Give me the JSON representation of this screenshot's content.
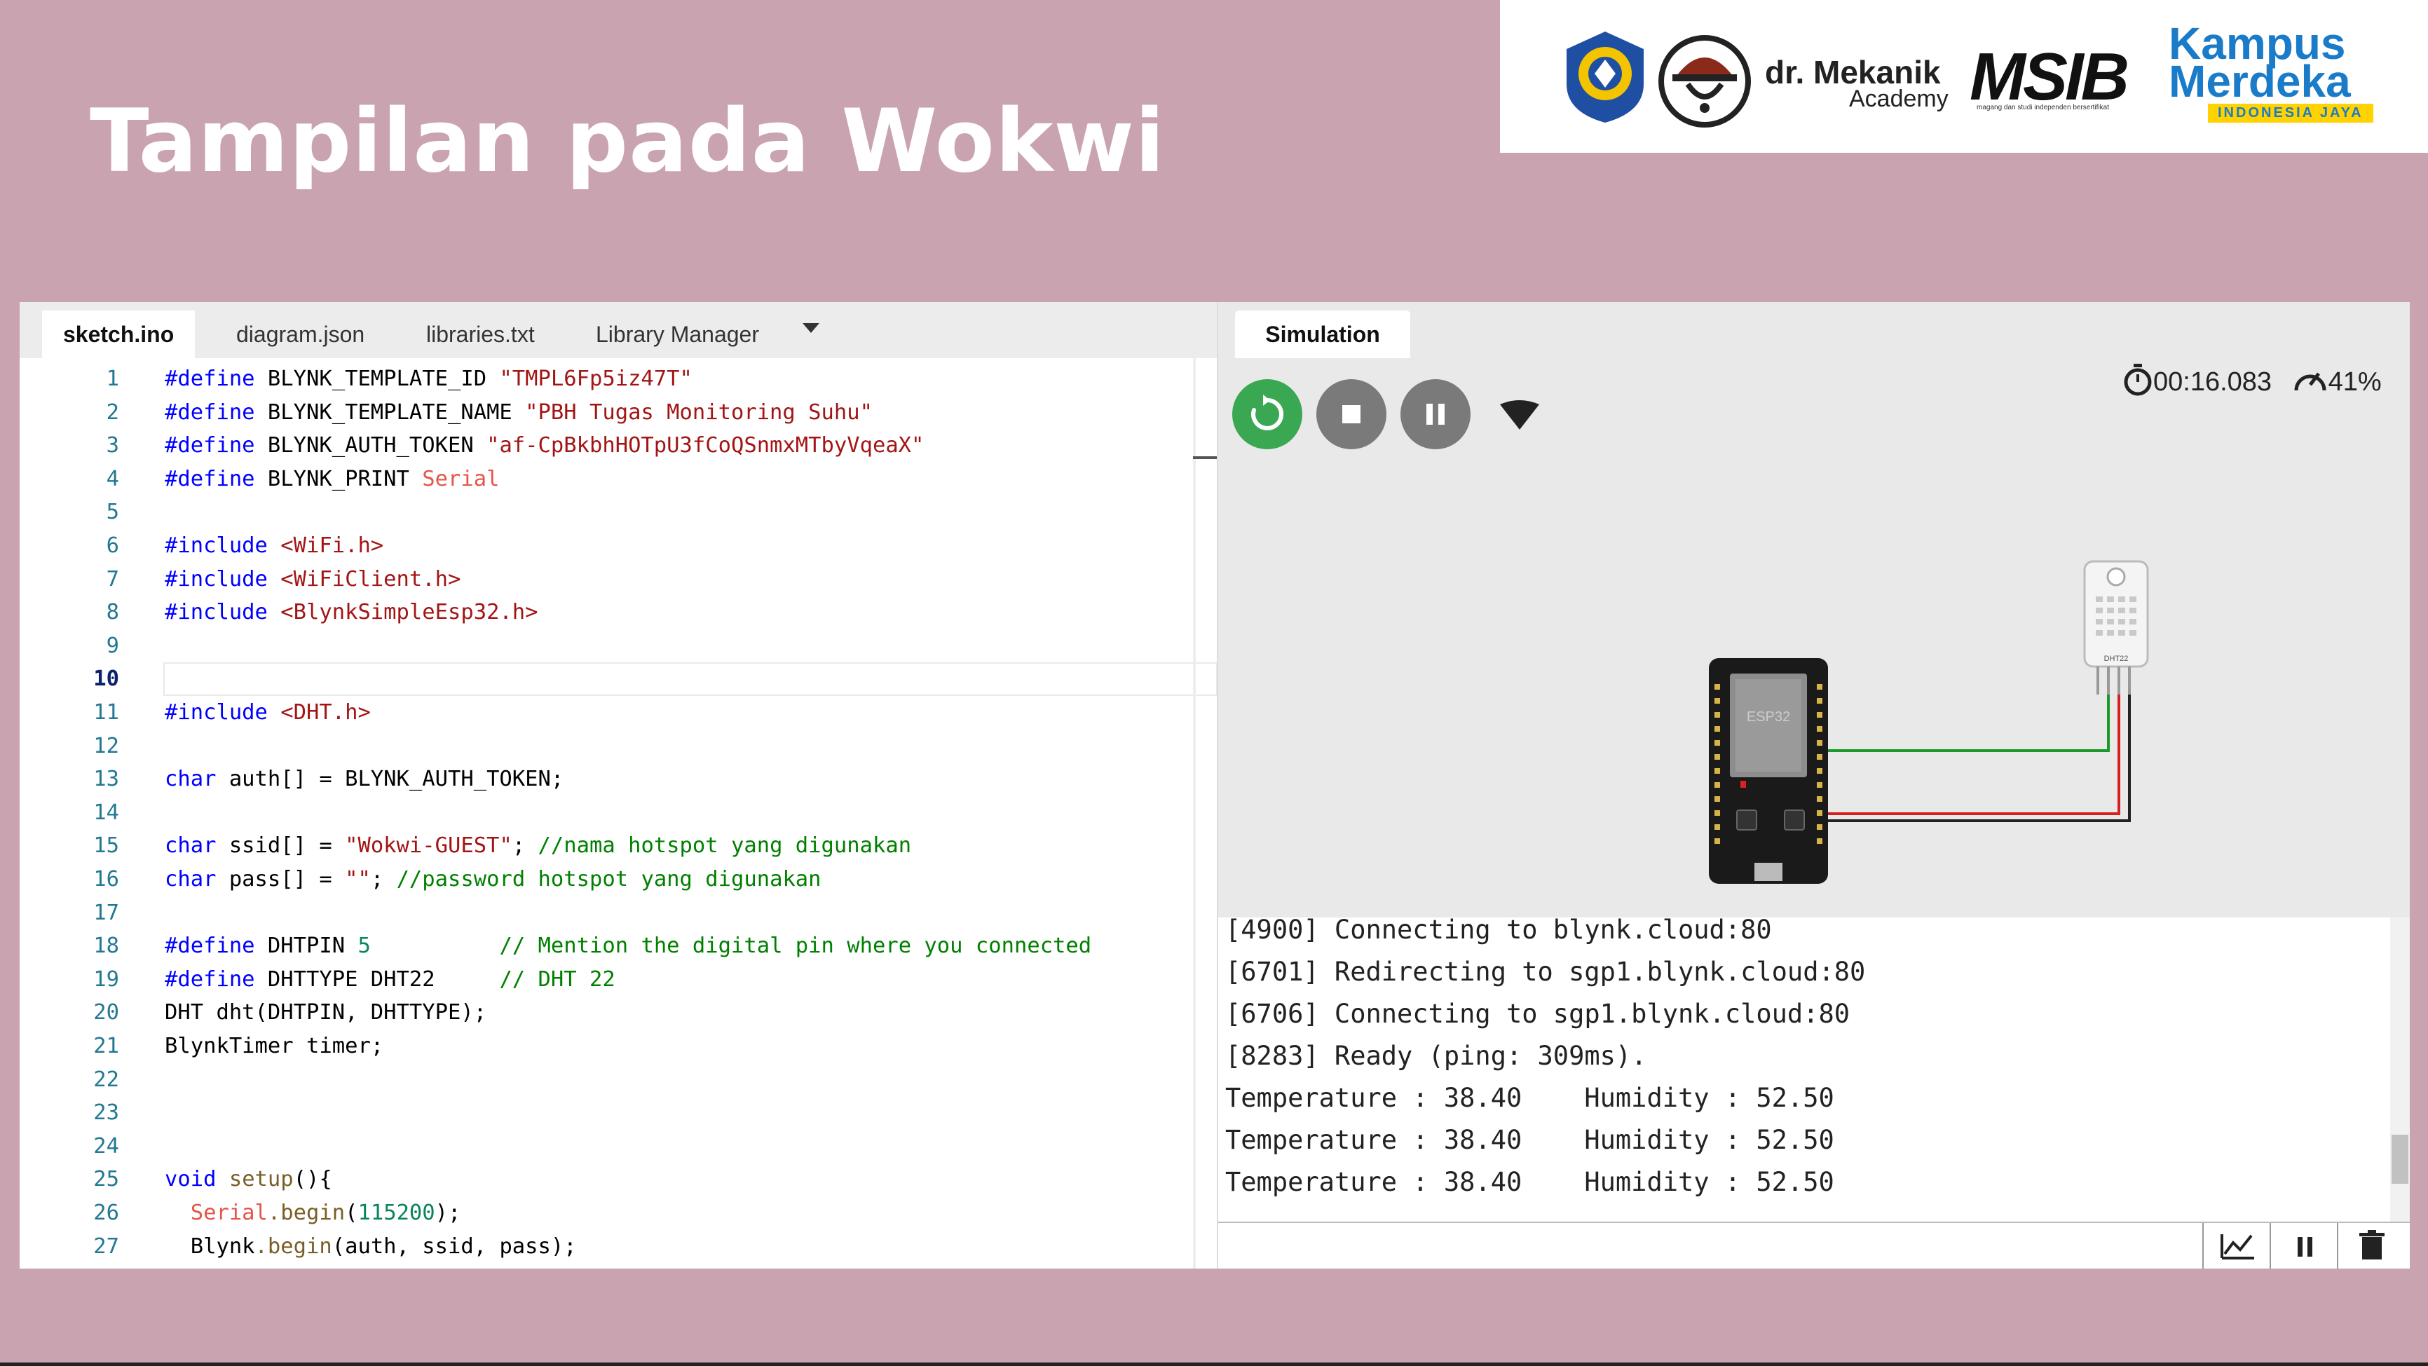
{
  "slide": {
    "title": "Tampilan pada Wokwi",
    "logos": {
      "academy_line1": "dr. Mekanik",
      "academy_line2": "Academy",
      "msib": "MSIB",
      "msib_tagline": "magang dan studi independen bersertifikat",
      "kampus_line1": "Kampus",
      "kampus_line2": "Merdeka",
      "kampus_line3": "INDONESIA JAYA"
    }
  },
  "editor": {
    "tabs": [
      "sketch.ino",
      "diagram.json",
      "libraries.txt",
      "Library Manager"
    ],
    "active_tab": "sketch.ino",
    "current_line": 10,
    "lines": [
      {
        "n": "1",
        "segs": [
          [
            "pp",
            "#define"
          ],
          [
            "",
            "BLYNK_TEMPLATE_ID "
          ],
          [
            "str",
            "\"TMPL6Fp5iz47T\""
          ]
        ]
      },
      {
        "n": "2",
        "segs": [
          [
            "pp",
            "#define"
          ],
          [
            "",
            "BLYNK_TEMPLATE_NAME "
          ],
          [
            "str",
            "\"PBH Tugas Monitoring Suhu\""
          ]
        ]
      },
      {
        "n": "3",
        "segs": [
          [
            "pp",
            "#define"
          ],
          [
            "",
            "BLYNK_AUTH_TOKEN "
          ],
          [
            "str",
            "\"af-CpBkbhHOTpU3fCoQSnmxMTbyVqeaX\""
          ]
        ]
      },
      {
        "n": "4",
        "segs": [
          [
            "pp",
            "#define"
          ],
          [
            "",
            "BLYNK_PRINT "
          ],
          [
            "red",
            "Serial"
          ]
        ]
      },
      {
        "n": "5",
        "segs": []
      },
      {
        "n": "6",
        "segs": [
          [
            "pp",
            "#include"
          ],
          [
            "str",
            "<WiFi.h>"
          ]
        ]
      },
      {
        "n": "7",
        "segs": [
          [
            "pp",
            "#include"
          ],
          [
            "str",
            "<WiFiClient.h>"
          ]
        ]
      },
      {
        "n": "8",
        "segs": [
          [
            "pp",
            "#include"
          ],
          [
            "str",
            "<BlynkSimpleEsp32.h>"
          ]
        ]
      },
      {
        "n": "9",
        "segs": []
      },
      {
        "n": "10",
        "segs": []
      },
      {
        "n": "11",
        "segs": [
          [
            "pp",
            "#include"
          ],
          [
            "str",
            "<DHT.h>"
          ]
        ]
      },
      {
        "n": "12",
        "segs": []
      },
      {
        "n": "13",
        "segs": [
          [
            "type",
            "char"
          ],
          [
            "",
            " auth[] = BLYNK_AUTH_TOKEN;"
          ]
        ]
      },
      {
        "n": "14",
        "segs": []
      },
      {
        "n": "15",
        "segs": [
          [
            "type",
            "char"
          ],
          [
            "",
            " ssid[] = "
          ],
          [
            "str",
            "\"Wokwi-GUEST\""
          ],
          [
            "",
            "; "
          ],
          [
            "cm",
            "//nama hotspot yang digunakan"
          ]
        ]
      },
      {
        "n": "16",
        "segs": [
          [
            "type",
            "char"
          ],
          [
            "",
            " pass[] = "
          ],
          [
            "str",
            "\"\""
          ],
          [
            "",
            "; "
          ],
          [
            "cm",
            "//password hotspot yang digunakan"
          ]
        ]
      },
      {
        "n": "17",
        "segs": []
      },
      {
        "n": "18",
        "segs": [
          [
            "pp",
            "#define"
          ],
          [
            "",
            "DHTPIN "
          ],
          [
            "num",
            "5"
          ],
          [
            "",
            "          "
          ],
          [
            "cm",
            "// Mention the digital pin where you connected"
          ]
        ]
      },
      {
        "n": "19",
        "segs": [
          [
            "pp",
            "#define"
          ],
          [
            "",
            "DHTTYPE DHT22     "
          ],
          [
            "cm",
            "// DHT 22"
          ]
        ]
      },
      {
        "n": "20",
        "segs": [
          [
            "",
            "DHT dht(DHTPIN, DHTTYPE);"
          ]
        ]
      },
      {
        "n": "21",
        "segs": [
          [
            "",
            "BlynkTimer timer;"
          ]
        ]
      },
      {
        "n": "22",
        "segs": []
      },
      {
        "n": "23",
        "segs": []
      },
      {
        "n": "24",
        "segs": []
      },
      {
        "n": "25",
        "segs": [
          [
            "type",
            "void"
          ],
          [
            "",
            " "
          ],
          [
            "fn",
            "setup"
          ],
          [
            "",
            "(){"
          ]
        ]
      },
      {
        "n": "26",
        "segs": [
          [
            "",
            "  "
          ],
          [
            "red",
            "Serial"
          ],
          [
            "fn",
            ".begin"
          ],
          [
            "",
            "("
          ],
          [
            "num",
            "115200"
          ],
          [
            "",
            ");"
          ]
        ]
      },
      {
        "n": "27",
        "segs": [
          [
            "",
            "  Blynk"
          ],
          [
            "fn",
            ".begin"
          ],
          [
            "",
            "(auth, ssid, pass);"
          ]
        ]
      }
    ]
  },
  "simulation": {
    "tab": "Simulation",
    "elapsed": "00:16.083",
    "speed": "41%",
    "board_label": "ESP32",
    "sensor_label": "DHT22",
    "serial_lines": [
      "[4900] Connecting to blynk.cloud:80",
      "[6701] Redirecting to sgp1.blynk.cloud:80",
      "[6706] Connecting to sgp1.blynk.cloud:80",
      "[8283] Ready (ping: 309ms).",
      "Temperature : 38.40    Humidity : 52.50",
      "Temperature : 38.40    Humidity : 52.50",
      "Temperature : 38.40    Humidity : 52.50"
    ]
  },
  "colors": {
    "background": "#caa3b0",
    "restart_button": "#3aa852",
    "control_button": "#7a7a7a"
  },
  "icons": [
    "restart-icon",
    "stop-icon",
    "pause-icon",
    "wifi-icon",
    "stopwatch-icon",
    "speedometer-icon",
    "chart-icon",
    "pause-serial-icon",
    "trash-icon"
  ]
}
